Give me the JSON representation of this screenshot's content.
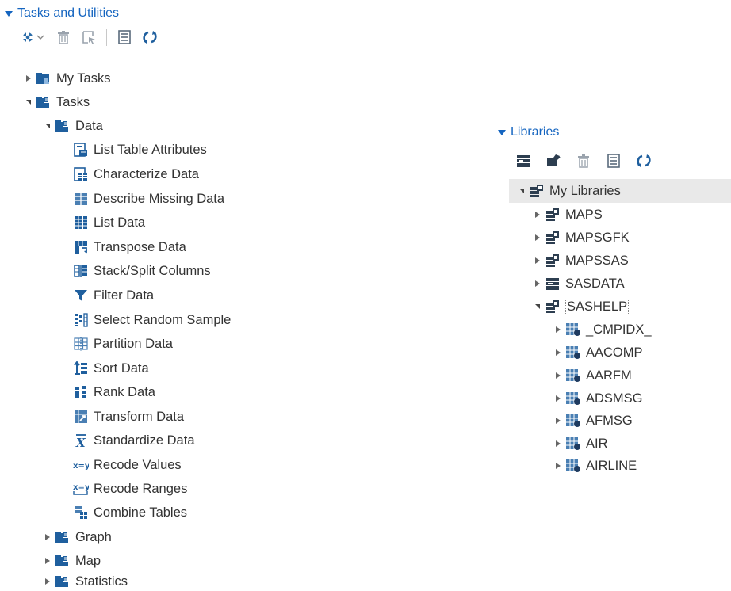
{
  "tasks_panel": {
    "header": "Tasks and Utilities",
    "toolbar": [
      {
        "name": "new-task-icon",
        "type": "dropdown"
      },
      {
        "name": "delete-icon"
      },
      {
        "name": "properties-icon"
      },
      {
        "name": "details-icon"
      },
      {
        "name": "refresh-icon"
      }
    ],
    "tree": {
      "my_tasks": "My Tasks",
      "tasks": "Tasks",
      "data": "Data",
      "data_items": [
        {
          "label": "List Table Attributes",
          "icon": "table-attributes-icon"
        },
        {
          "label": "Characterize Data",
          "icon": "characterize-data-icon"
        },
        {
          "label": "Describe Missing Data",
          "icon": "missing-data-icon"
        },
        {
          "label": "List Data",
          "icon": "list-data-icon"
        },
        {
          "label": "Transpose Data",
          "icon": "transpose-icon"
        },
        {
          "label": "Stack/Split Columns",
          "icon": "stack-split-icon"
        },
        {
          "label": "Filter Data",
          "icon": "filter-icon"
        },
        {
          "label": "Select Random Sample",
          "icon": "random-sample-icon"
        },
        {
          "label": "Partition Data",
          "icon": "partition-icon"
        },
        {
          "label": "Sort Data",
          "icon": "sort-icon"
        },
        {
          "label": "Rank Data",
          "icon": "rank-icon"
        },
        {
          "label": "Transform Data",
          "icon": "transform-icon"
        },
        {
          "label": "Standardize Data",
          "icon": "standardize-icon"
        },
        {
          "label": "Recode Values",
          "icon": "recode-values-icon"
        },
        {
          "label": "Recode Ranges",
          "icon": "recode-ranges-icon"
        },
        {
          "label": "Combine Tables",
          "icon": "combine-tables-icon"
        }
      ],
      "graph": "Graph",
      "map": "Map",
      "statistics": "Statistics"
    }
  },
  "libraries_panel": {
    "header": "Libraries",
    "toolbar": [
      {
        "name": "new-library-icon"
      },
      {
        "name": "library-properties-icon"
      },
      {
        "name": "delete-icon"
      },
      {
        "name": "details-icon"
      },
      {
        "name": "refresh-icon"
      }
    ],
    "tree": {
      "root": "My Libraries",
      "libraries": [
        "MAPS",
        "MAPSGFK",
        "MAPSSAS",
        "SASDATA"
      ],
      "expanded": "SASHELP",
      "tables": [
        "_CMPIDX_",
        "AACOMP",
        "AARFM",
        "ADSMSG",
        "AFMSG",
        "AIR",
        "AIRLINE"
      ]
    }
  },
  "colors": {
    "accent": "#1565c0",
    "icon_blue": "#1f5f9e",
    "icon_dark": "#2d3e50"
  }
}
